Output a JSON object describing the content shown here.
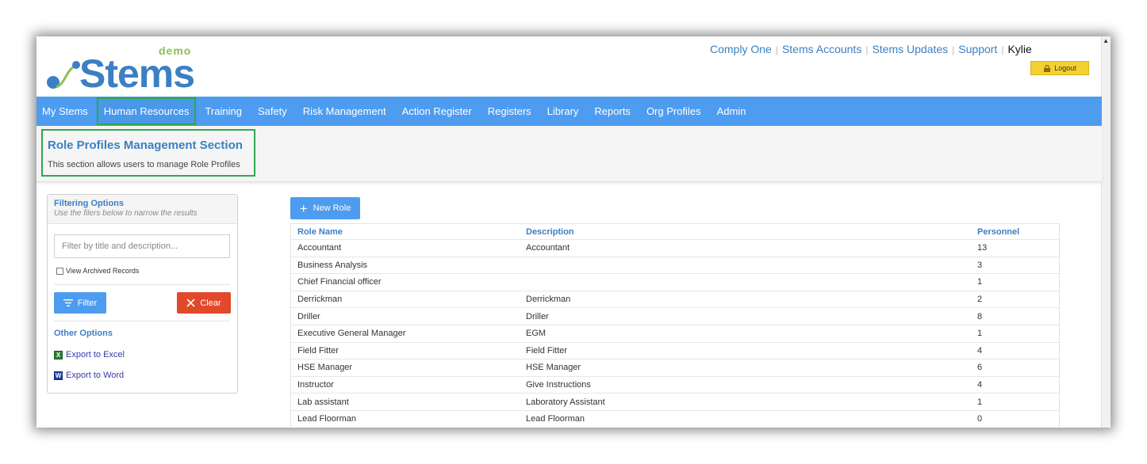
{
  "brand": {
    "name": "Stems",
    "tag": "demo"
  },
  "top_links": [
    {
      "label": "Comply One"
    },
    {
      "label": "Stems Accounts"
    },
    {
      "label": "Stems Updates"
    },
    {
      "label": "Support"
    }
  ],
  "user": {
    "name": "Kylie",
    "logout_label": "Logout"
  },
  "nav": [
    {
      "label": "My Stems"
    },
    {
      "label": "Human Resources",
      "active": true
    },
    {
      "label": "Training"
    },
    {
      "label": "Safety"
    },
    {
      "label": "Risk Management"
    },
    {
      "label": "Action Register"
    },
    {
      "label": "Registers"
    },
    {
      "label": "Library"
    },
    {
      "label": "Reports"
    },
    {
      "label": "Org Profiles"
    },
    {
      "label": "Admin"
    }
  ],
  "section": {
    "title": "Role Profiles Management Section",
    "subtitle": "This section allows users to manage Role Profiles"
  },
  "filter_panel": {
    "title": "Filtering Options",
    "hint": "Use the filers below to narrow the results",
    "search_placeholder": "Filter by title and description...",
    "search_value": "",
    "archived_label": "View Archived Records",
    "archived_checked": false,
    "filter_label": "Filter",
    "clear_label": "Clear",
    "other_title": "Other Options",
    "export_excel": "Export to Excel",
    "export_word": "Export to Word"
  },
  "new_role_label": "New Role",
  "table": {
    "headers": [
      "Role Name",
      "Description",
      "Personnel"
    ],
    "rows": [
      {
        "name": "Accountant",
        "description": "Accountant",
        "personnel": "13"
      },
      {
        "name": "Business Analysis",
        "description": "",
        "personnel": "3"
      },
      {
        "name": "Chief Financial officer",
        "description": "",
        "personnel": "1"
      },
      {
        "name": "Derrickman",
        "description": "Derrickman",
        "personnel": "2"
      },
      {
        "name": "Driller",
        "description": "Driller",
        "personnel": "8"
      },
      {
        "name": "Executive General Manager",
        "description": "EGM",
        "personnel": "1"
      },
      {
        "name": "Field Fitter",
        "description": "Field Fitter",
        "personnel": "4"
      },
      {
        "name": "HSE Manager",
        "description": "HSE Manager",
        "personnel": "6"
      },
      {
        "name": "Instructor",
        "description": "Give Instructions",
        "personnel": "4"
      },
      {
        "name": "Lab assistant",
        "description": "Laboratory Assistant",
        "personnel": "1"
      },
      {
        "name": "Lead Floorman",
        "description": "Lead Floorman",
        "personnel": "0"
      }
    ]
  },
  "colors": {
    "brand_blue": "#3c7fc3",
    "nav_blue": "#4d9cf0",
    "highlight_green": "#2fa84f",
    "clear_red": "#e04a2b",
    "logout_yellow": "#f4d033"
  }
}
